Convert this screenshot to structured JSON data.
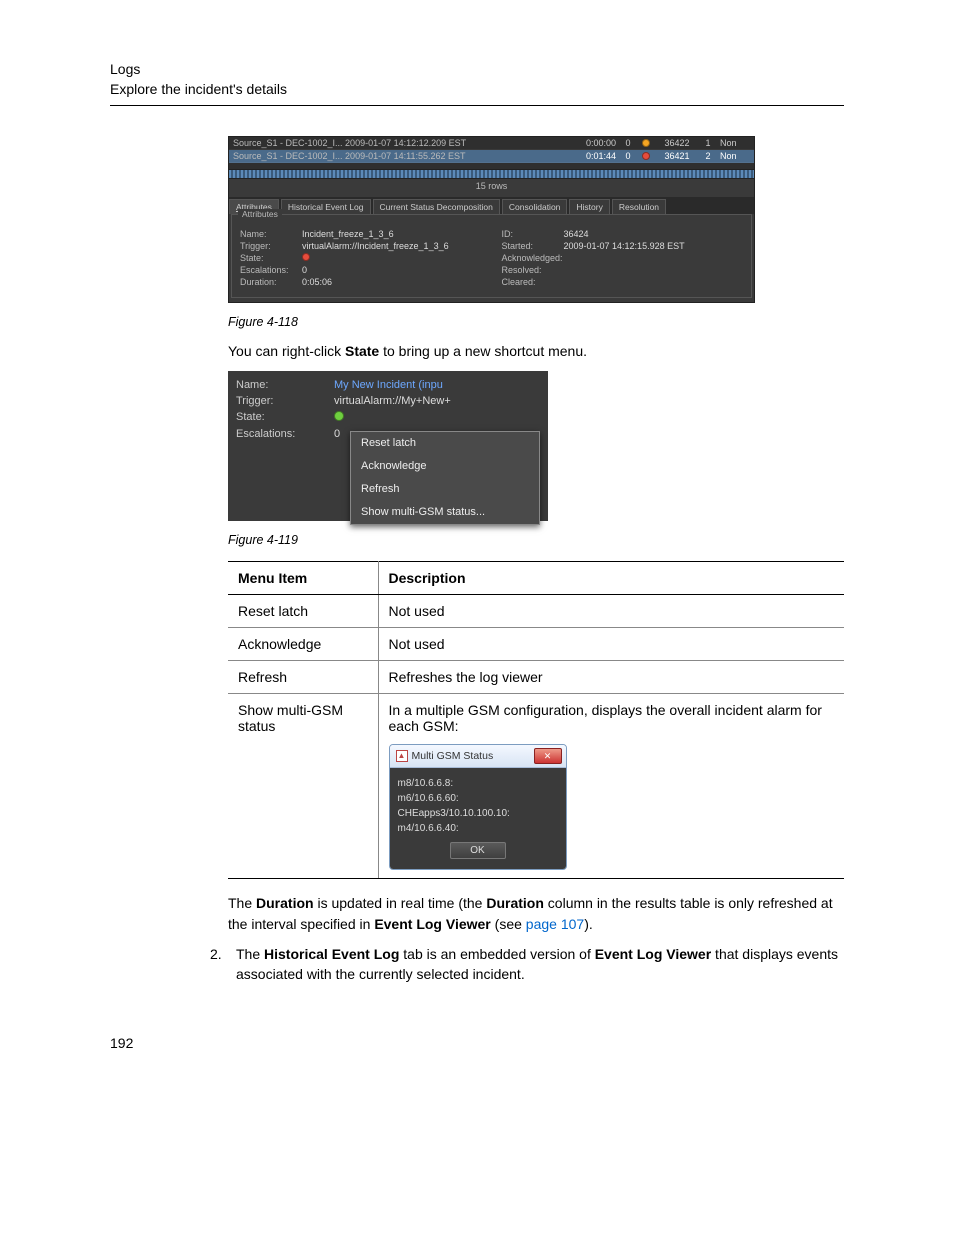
{
  "header": {
    "line1": "Logs",
    "line2": "Explore the incident's details"
  },
  "fig118": {
    "caption": "Figure 4-118",
    "rows": [
      {
        "name": "Source_S1 - DEC-1002_I... 2009-01-07 14:12:12.209 EST",
        "dur": "0:00:00",
        "idx1": "0",
        "dot": "orange",
        "id": "36422",
        "idx2": "1",
        "end": "Non"
      },
      {
        "name": "Source_S1 - DEC-1002_I... 2009-01-07 14:11:55.262 EST",
        "dur": "0:01:44",
        "idx1": "0",
        "dot": "red",
        "id": "36421",
        "idx2": "2",
        "end": "Non"
      }
    ],
    "count_label": "15 rows",
    "tabs": [
      "Attributes",
      "Historical Event Log",
      "Current Status Decomposition",
      "Consolidation",
      "History",
      "Resolution"
    ],
    "attr_legend": "Attributes",
    "left_attrs": [
      {
        "label": "Name:",
        "value": "Incident_freeze_1_3_6"
      },
      {
        "label": "Trigger:",
        "value": "virtualAlarm://Incident_freeze_1_3_6"
      },
      {
        "label": "State:",
        "value_dot": "red"
      },
      {
        "label": "Escalations:",
        "value": "0"
      },
      {
        "label": "Duration:",
        "value": "0:05:06"
      }
    ],
    "right_attrs": [
      {
        "label": "ID:",
        "value": "36424"
      },
      {
        "label": "Started:",
        "value": "2009-01-07 14:12:15.928 EST"
      },
      {
        "label": "Acknowledged:",
        "value": ""
      },
      {
        "label": "Resolved:",
        "value": ""
      },
      {
        "label": "Cleared:",
        "value": ""
      }
    ]
  },
  "text_after_118_pre": "You can right-click ",
  "text_after_118_bold": "State",
  "text_after_118_post": " to bring up a new shortcut menu.",
  "fig119": {
    "caption": "Figure 4-119",
    "attrs": [
      {
        "label": "Name:",
        "value": "My New Incident (inpu"
      },
      {
        "label": "Trigger:",
        "value": "virtualAlarm://My+New+"
      },
      {
        "label": "State:",
        "value_dot": "green"
      },
      {
        "label": "Escalations:",
        "value": "0"
      }
    ],
    "menu_items": [
      "Reset latch",
      "Acknowledge",
      "Refresh",
      "Show multi-GSM status..."
    ]
  },
  "menu_table": {
    "head": [
      "Menu Item",
      "Description"
    ],
    "rows": [
      {
        "item": "Reset latch",
        "desc": "Not used"
      },
      {
        "item": "Acknowledge",
        "desc": "Not used"
      },
      {
        "item": "Refresh",
        "desc": "Refreshes the log viewer"
      },
      {
        "item": "Show multi-GSM status",
        "desc": "In a multiple GSM configuration, displays the overall incident alarm for each GSM:"
      }
    ]
  },
  "gsm_dialog": {
    "title": "Multi GSM Status",
    "close_glyph": "✕",
    "rows": [
      {
        "label": "m8/10.6.6.8:",
        "dot": "orange"
      },
      {
        "label": "m6/10.6.6.60:",
        "dot": "orange"
      },
      {
        "label": "CHEapps3/10.10.100.10:",
        "dot": "blue"
      },
      {
        "label": "m4/10.6.6.40:",
        "dot": "orange"
      }
    ],
    "ok_label": "OK"
  },
  "duration_para": {
    "pre": "The ",
    "b1": "Duration",
    "mid1": " is updated in real time (the ",
    "b2": "Duration",
    "mid2": " column in the results table is only refreshed at the interval specified in ",
    "b3": "Event Log Viewer",
    "mid3": " (see ",
    "link": "page 107",
    "post": ")."
  },
  "step2": {
    "num": "2.",
    "pre": "The ",
    "b1": "Historical Event Log",
    "mid1": " tab is an embedded version of ",
    "b2": "Event Log Viewer",
    "post": " that displays events associated with the currently selected incident."
  },
  "page_number": "192"
}
